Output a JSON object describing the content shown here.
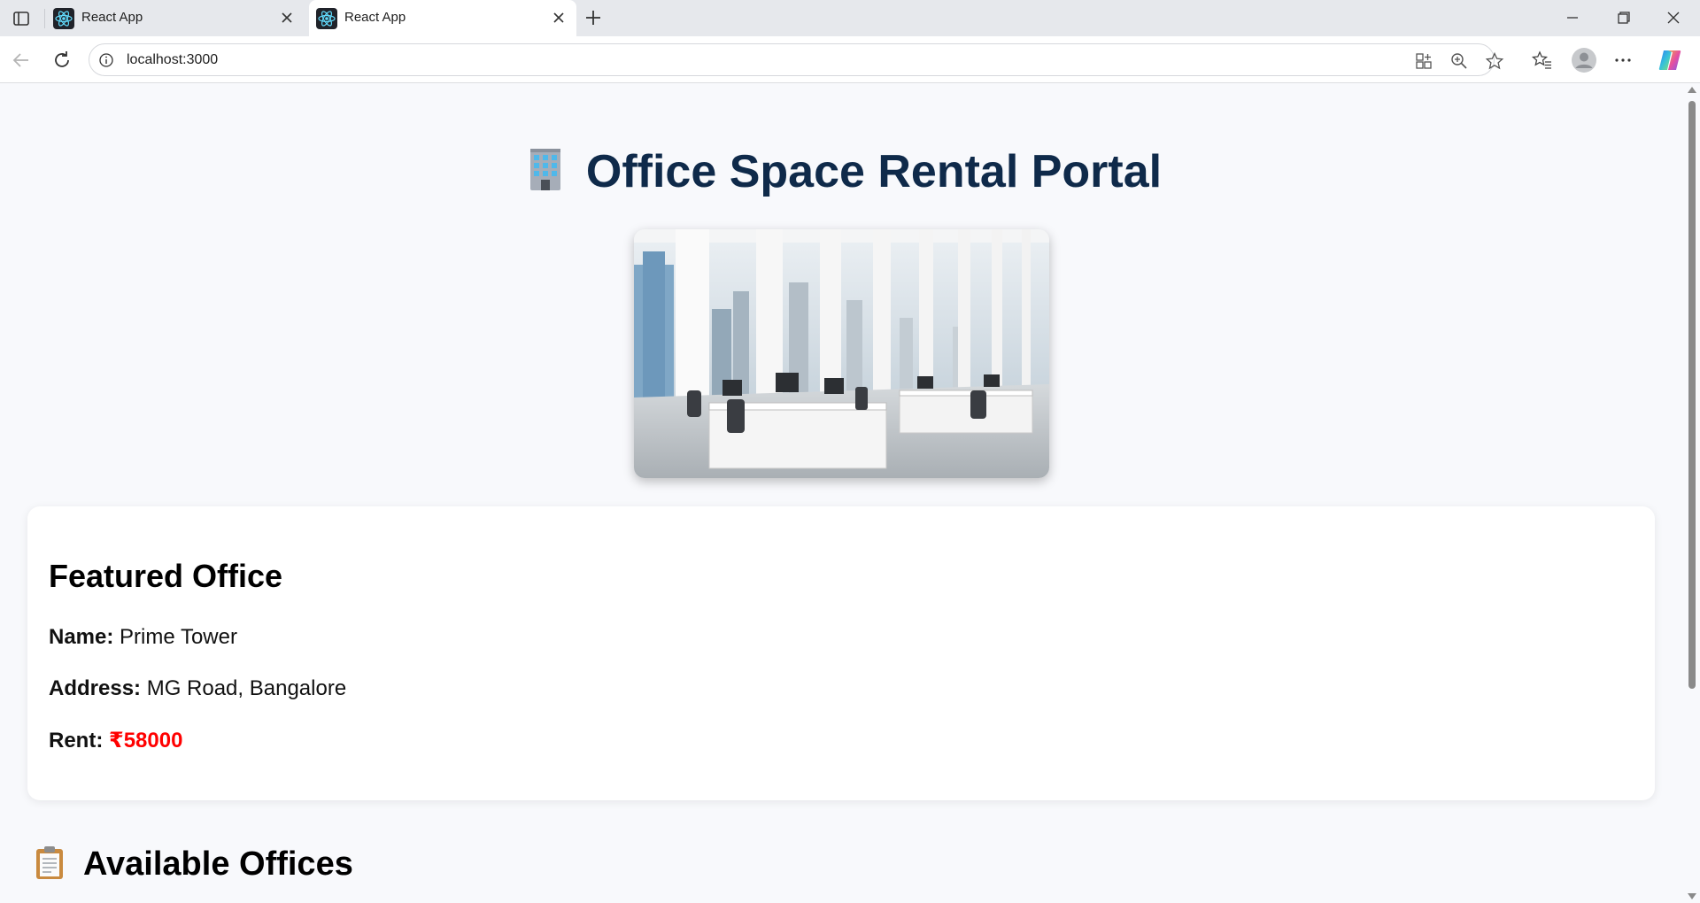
{
  "browser": {
    "tabs": [
      {
        "title": "React App",
        "active": false
      },
      {
        "title": "React App",
        "active": true
      }
    ],
    "url": "localhost:3000"
  },
  "page": {
    "title": "Office Space Rental Portal",
    "featured": {
      "heading": "Featured Office",
      "name_label": "Name:",
      "name_value": "Prime Tower",
      "address_label": "Address:",
      "address_value": "MG Road, Bangalore",
      "rent_label": "Rent:",
      "rent_value": "₹58000"
    },
    "available_heading": "Available Offices"
  },
  "colors": {
    "title": "#0f2a4a",
    "rent": "#ff0000",
    "page_bg": "#f8f9fc"
  },
  "icons": [
    "sidebar-toggle-icon",
    "react-logo-icon",
    "close-icon",
    "plus-icon",
    "minimize-icon",
    "restore-icon",
    "back-icon",
    "refresh-icon",
    "info-icon",
    "app-available-icon",
    "zoom-icon",
    "star-icon",
    "favorites-icon",
    "profile-icon",
    "more-icon",
    "copilot-icon",
    "office-building-icon",
    "clipboard-icon"
  ]
}
